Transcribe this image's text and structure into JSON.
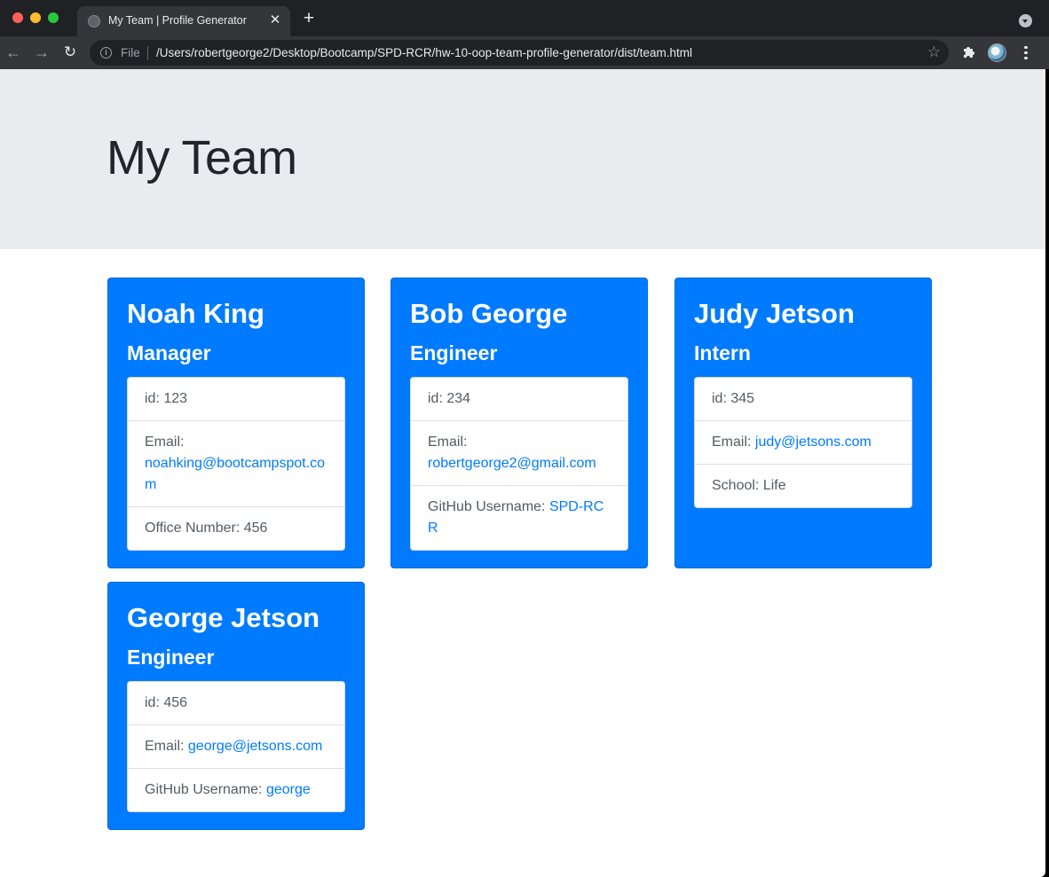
{
  "browser": {
    "tab_title": "My Team | Profile Generator",
    "scheme_label": "File",
    "url": "/Users/robertgeorge2/Desktop/Bootcamp/SPD-RCR/hw-10-oop-team-profile-generator/dist/team.html"
  },
  "page": {
    "title": "My Team"
  },
  "team": [
    {
      "name": "Noah King",
      "role": "Manager",
      "id_label": "id: 123",
      "email_prefix": "Email:",
      "email": "noahking@bootcampspot.com",
      "extra_label": "Office Number: 456",
      "extra_link": ""
    },
    {
      "name": "Bob George",
      "role": "Engineer",
      "id_label": "id: 234",
      "email_prefix": "Email:",
      "email": "robertgeorge2@gmail.com",
      "extra_label": "GitHub Username:",
      "extra_link": "SPD-RCR"
    },
    {
      "name": "Judy Jetson",
      "role": "Intern",
      "id_label": "id: 345",
      "email_prefix": "Email:",
      "email": "judy@jetsons.com",
      "extra_label": "School: Life",
      "extra_link": ""
    },
    {
      "name": "George Jetson",
      "role": "Engineer",
      "id_label": "id: 456",
      "email_prefix": "Email:",
      "email": "george@jetsons.com",
      "extra_label": "GitHub Username:",
      "extra_link": "george"
    }
  ],
  "colors": {
    "card_background": "#007bff",
    "jumbotron_background": "#e9ecef",
    "link": "#007bff"
  }
}
